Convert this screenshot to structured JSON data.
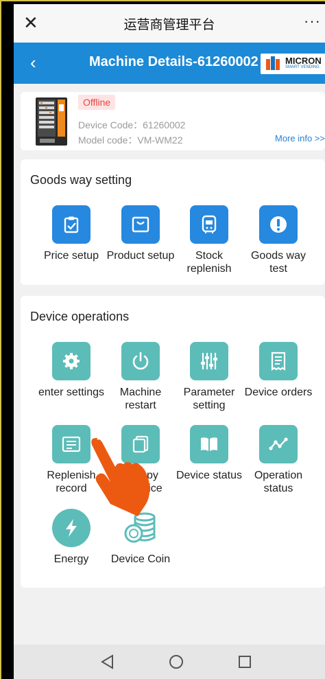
{
  "titlebar": {
    "close_glyph": "✕",
    "title": "运营商管理平台",
    "more_glyph": "···"
  },
  "header": {
    "back_glyph": "‹",
    "title": "Machine Details-61260002",
    "logo": {
      "brand": "MICRON",
      "tagline": "SMART VENDING"
    },
    "bg_color": "#1c8ad6"
  },
  "device": {
    "status": "Offline",
    "device_code": "Device Code：61260002",
    "model_code": "Model code：VM-WM22",
    "more_info": "More info >>"
  },
  "goods_way": {
    "title": "Goods way setting",
    "items": [
      {
        "label": "Price setup",
        "icon": "clipboard-check-icon"
      },
      {
        "label": "Product setup",
        "icon": "product-box-icon"
      },
      {
        "label": "Stock replenish",
        "icon": "stock-device-icon"
      },
      {
        "label": "Goods way test",
        "icon": "exclamation-icon"
      }
    ]
  },
  "device_ops": {
    "title": "Device operations",
    "items": [
      {
        "label": "enter settings",
        "icon": "gear-icon"
      },
      {
        "label": "Machine restart",
        "icon": "power-icon"
      },
      {
        "label": "Parameter setting",
        "icon": "sliders-icon"
      },
      {
        "label": "Device orders",
        "icon": "receipt-icon"
      },
      {
        "label": "Replenish record",
        "icon": "replenish-record-icon"
      },
      {
        "label": "Copy device",
        "icon": "copy-icon"
      },
      {
        "label": "Device status",
        "icon": "book-icon"
      },
      {
        "label": "Operation status",
        "icon": "line-graph-icon"
      },
      {
        "label": "Energy",
        "icon": "lightning-icon"
      },
      {
        "label": "Device Coin",
        "icon": "coin-stack-icon"
      }
    ]
  },
  "visible_labels": {
    "replenish_l1": "Replenish",
    "replenish_l2": "record",
    "copy_l1": "opy",
    "copy_l2": "evice"
  },
  "navbar": {
    "back": "◁",
    "home": "○",
    "recent": "□"
  },
  "colors": {
    "accent_blue": "#2688de",
    "teal": "#5cbcb8",
    "offline_red": "#e64545"
  }
}
